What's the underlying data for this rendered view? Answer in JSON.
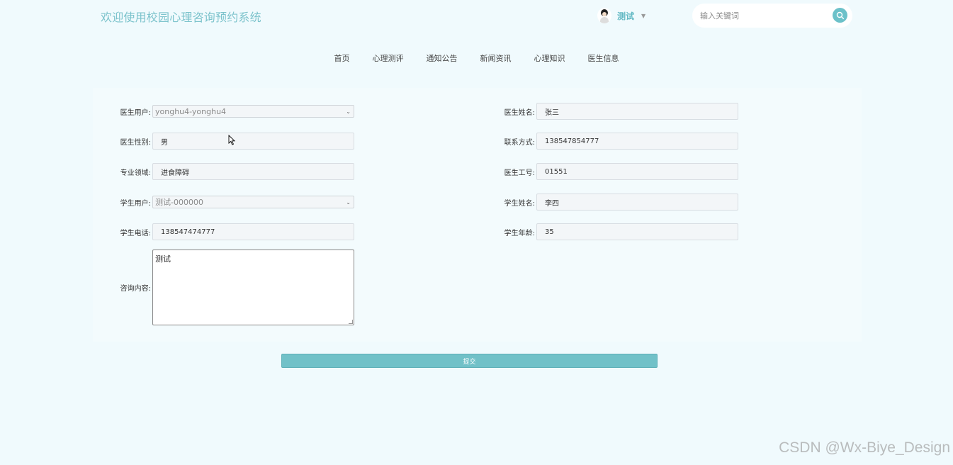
{
  "header": {
    "site_title": "欢迎使用校园心理咨询预约系统",
    "username": "测试",
    "search_placeholder": "输入关键词"
  },
  "nav": {
    "items": [
      {
        "label": "首页"
      },
      {
        "label": "心理测评"
      },
      {
        "label": "通知公告"
      },
      {
        "label": "新闻资讯"
      },
      {
        "label": "心理知识"
      },
      {
        "label": "医生信息"
      }
    ]
  },
  "form": {
    "doctor_user": {
      "label": "医生用户:",
      "value": "yonghu4-yonghu4"
    },
    "doctor_name": {
      "label": "医生姓名:",
      "value": "张三"
    },
    "doctor_gender": {
      "label": "医生性别:",
      "value": "男"
    },
    "contact": {
      "label": "联系方式:",
      "value": "138547854777"
    },
    "specialty": {
      "label": "专业领域:",
      "value": "进食障碍"
    },
    "doctor_id": {
      "label": "医生工号:",
      "value": "01551"
    },
    "student_user": {
      "label": "学生用户:",
      "value": "测试-000000"
    },
    "student_name": {
      "label": "学生姓名:",
      "value": "李四"
    },
    "student_phone": {
      "label": "学生电话:",
      "value": "138547474777"
    },
    "student_age": {
      "label": "学生年龄:",
      "value": "35"
    },
    "consult_content": {
      "label": "咨询内容:",
      "value": "测试"
    }
  },
  "submit_label": "提交",
  "watermark": "CSDN @Wx-Biye_Design",
  "colors": {
    "accent": "#71c1c8",
    "title": "#7cc3cc",
    "background": "#f0fafd"
  }
}
